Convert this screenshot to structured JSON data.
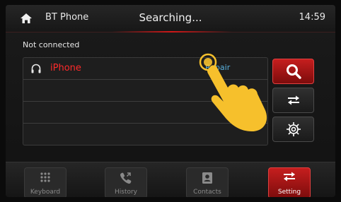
{
  "header": {
    "app_title": "BT Phone",
    "status": "Searching...",
    "time": "14:59",
    "icon": "home-icon"
  },
  "connection_status": "Not connected",
  "devices": [
    {
      "name": "iPhone",
      "action": "Repair",
      "icon": "headphones-icon"
    }
  ],
  "side_buttons": [
    {
      "name": "search",
      "icon": "search-icon"
    },
    {
      "name": "swap",
      "icon": "swap-arrows-icon"
    },
    {
      "name": "settings",
      "icon": "gear-icon"
    }
  ],
  "bottom_tabs": [
    {
      "label": "Keyboard",
      "icon": "keypad-icon",
      "active": false
    },
    {
      "label": "History",
      "icon": "phone-history-icon",
      "active": false
    },
    {
      "label": "Contacts",
      "icon": "contacts-icon",
      "active": false
    },
    {
      "label": "Setting",
      "icon": "swap-arrows-icon",
      "active": true
    }
  ],
  "colors": {
    "accent_red": "#c51e1e",
    "device_name": "#ff2a2a",
    "link_blue": "#59b1de",
    "pointer_hand": "#f6c02c"
  }
}
